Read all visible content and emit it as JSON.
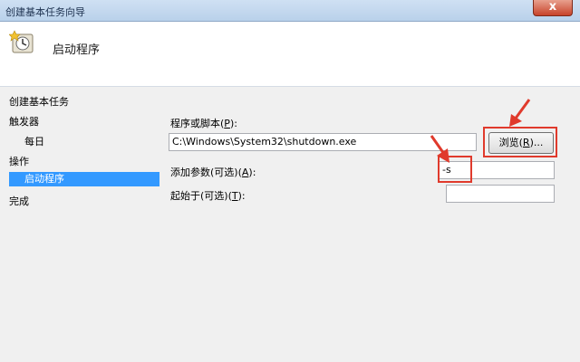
{
  "window": {
    "title": "创建基本任务向导",
    "close_label": "x"
  },
  "header": {
    "title": "启动程序"
  },
  "sidebar": {
    "items": [
      {
        "label": "创建基本任务"
      },
      {
        "label": "触发器"
      },
      {
        "label": "每日"
      },
      {
        "label": "操作"
      },
      {
        "label": "启动程序",
        "selected": true
      },
      {
        "label": "完成"
      }
    ]
  },
  "form": {
    "program_label": "程序或脚本(",
    "program_key": "P",
    "program_label_end": "):",
    "program_value": "C:\\Windows\\System32\\shutdown.exe",
    "browse_label": "浏览(",
    "browse_key": "R",
    "browse_label_end": ")...",
    "args_label": "添加参数(可选)(",
    "args_key": "A",
    "args_label_end": "):",
    "args_value": "-s",
    "start_label": "起始于(可选)(",
    "start_key": "T",
    "start_label_end": "):",
    "start_value": ""
  },
  "colors": {
    "selected": "#3399ff",
    "annotation": "#e03a2c"
  }
}
